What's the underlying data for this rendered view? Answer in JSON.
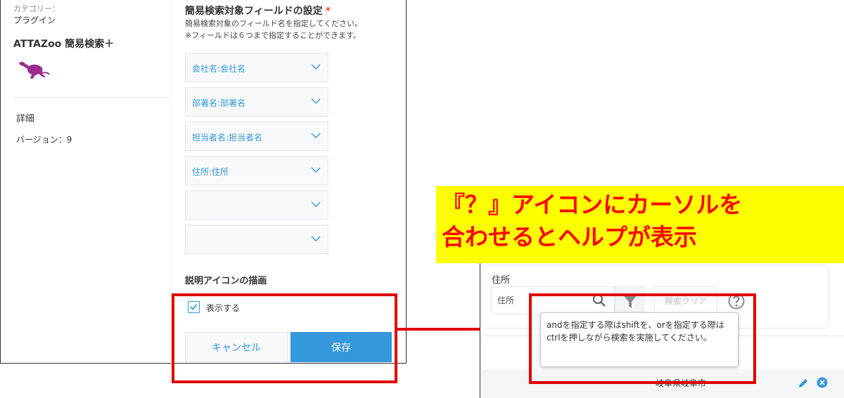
{
  "plugin": {
    "category_label": "カテゴリー：",
    "category": "プラグイン",
    "name": "ATTAZoo 簡易検索＋",
    "details_label": "詳細",
    "version": "バージョン：9"
  },
  "settings": {
    "title": "簡易検索対象フィールドの設定",
    "required_mark": "*",
    "description_1": "簡易検索対象のフィールド名を指定してください。",
    "description_2": "※フィールドは６つまで指定することができます。",
    "fields": [
      "会社名:会社名",
      "部署名:部署名",
      "担当者名:担当者名",
      "住所:住所",
      "",
      ""
    ],
    "icon_section_title": "説明アイコンの描画",
    "show_label": "表示する",
    "show_checked": true,
    "cancel_label": "キャンセル",
    "save_label": "保存"
  },
  "callout": {
    "line1": "『？』アイコンにカーソルを",
    "line2": "合わせるとヘルプが表示"
  },
  "search": {
    "field_label": "住所",
    "input_placeholder": "住所",
    "clear_label": "検索クリア",
    "tooltip": "andを指定する際はshiftを、orを指定する際はctrlを押しながら検索を実施してください。",
    "row_value": "岐阜県岐阜市"
  },
  "colors": {
    "accent": "#3498db",
    "highlight_frame": "#e00000",
    "callout_bg": "#ffff00",
    "callout_text": "#ff0000"
  },
  "icons": {
    "logo": "kangaroo-icon",
    "select": "chevron-down-icon",
    "checkbox": "checkmark-icon",
    "search": "search-icon",
    "filter": "filter-icon",
    "help": "help-icon",
    "edit": "pencil-icon",
    "remove": "close-circle-icon"
  }
}
